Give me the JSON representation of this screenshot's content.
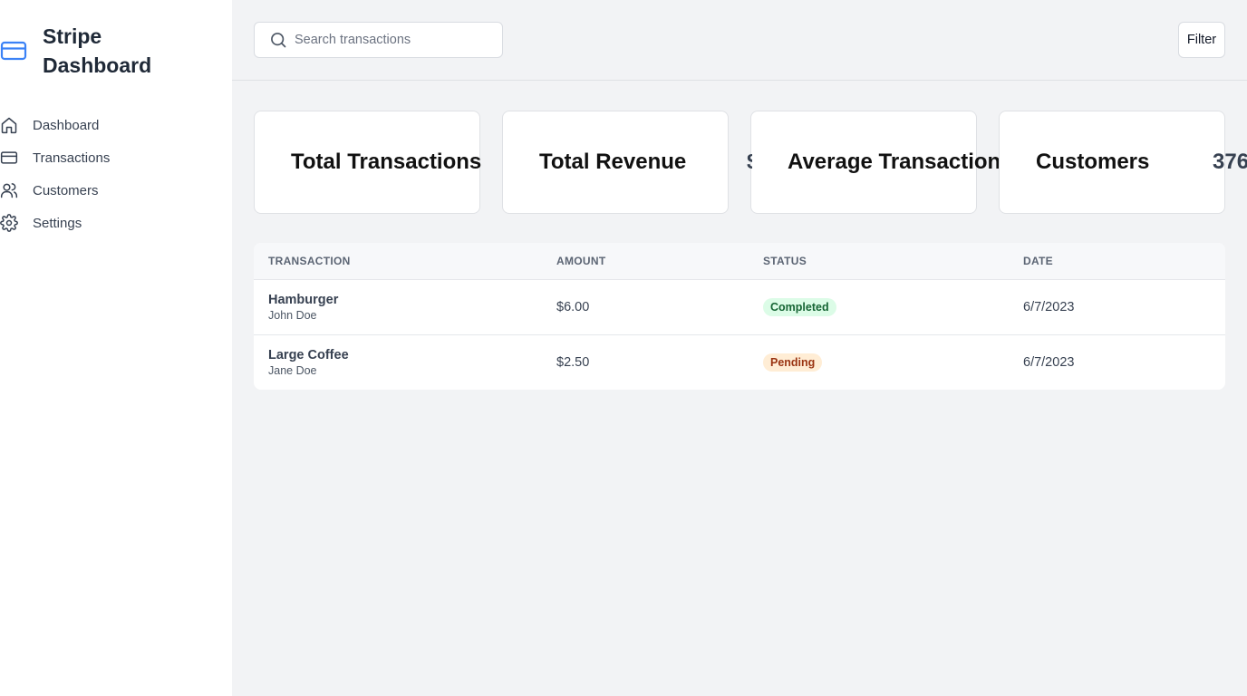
{
  "app": {
    "title": "Stripe Dashboard",
    "brand_icon": "credit-card-icon",
    "accent_color": "#3b82f6"
  },
  "sidebar": {
    "items": [
      {
        "label": "Dashboard",
        "icon": "home-icon"
      },
      {
        "label": "Transactions",
        "icon": "credit-card-icon"
      },
      {
        "label": "Customers",
        "icon": "users-icon"
      },
      {
        "label": "Settings",
        "icon": "gear-icon"
      }
    ]
  },
  "header": {
    "search": {
      "placeholder": "Search transactions",
      "value": "",
      "icon": "search-icon"
    },
    "filter_label": "Filter"
  },
  "cards": [
    {
      "title": "Total Transactions",
      "value": ""
    },
    {
      "title": "Total Revenue",
      "value": "$"
    },
    {
      "title": "Average Transaction",
      "value": ""
    },
    {
      "title": "Customers",
      "value": "376"
    }
  ],
  "table": {
    "columns": [
      "TRANSACTION",
      "AMOUNT",
      "STATUS",
      "DATE"
    ],
    "rows": [
      {
        "name": "Hamburger",
        "customer": "John Doe",
        "amount": "$6.00",
        "status": "Completed",
        "date": "6/7/2023"
      },
      {
        "name": "Large Coffee",
        "customer": "Jane Doe",
        "amount": "$2.50",
        "status": "Pending",
        "date": "6/7/2023"
      }
    ]
  },
  "colors": {
    "completed_bg": "#dcfce7",
    "completed_text": "#166534",
    "pending_bg": "#ffedd5",
    "pending_text": "#9a3412"
  }
}
